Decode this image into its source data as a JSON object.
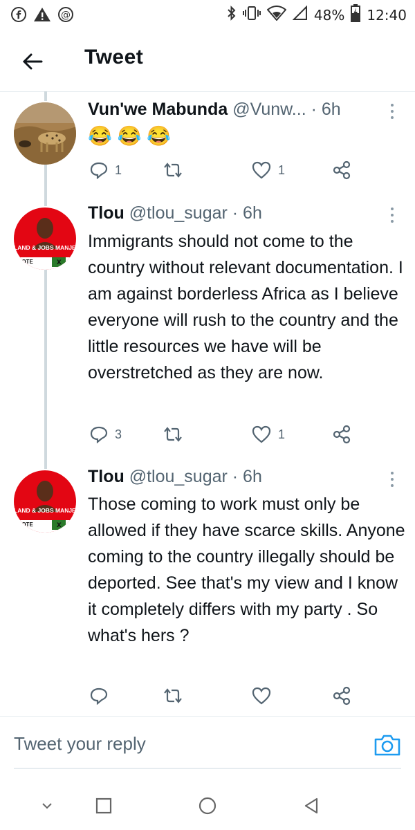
{
  "status_bar": {
    "left_icons": [
      "facebook-icon",
      "warning-icon",
      "at-icon"
    ],
    "battery": "48%",
    "time": "12:40"
  },
  "header": {
    "title": "Tweet"
  },
  "tweets": [
    {
      "name": "Vun'we Mabunda",
      "handle_time": "@Vunw... · 6h",
      "text": "😂 😂 😂",
      "replies": "1",
      "retweets": "",
      "likes": "1"
    },
    {
      "name": "Tlou",
      "handle_time": "@tlou_sugar · 6h",
      "text": "Immigrants should not come to the country without relevant documentation. I am against borderless Africa as I believe everyone will rush to the country and the little resources we have will be overstretched as they are now.",
      "replies": "3",
      "retweets": "",
      "likes": "1",
      "avatar_text": "LAND & JOBS MANJE!",
      "avatar_vote": "VOTE"
    },
    {
      "name": "Tlou",
      "handle_time": "@tlou_sugar · 6h",
      "text": "Those coming to work must only be allowed if they have scarce skills. Anyone coming to the country illegally should be deported. See that's my view and I know it completely differs with my party . So what's hers ?",
      "replies": "",
      "retweets": "",
      "likes": "",
      "avatar_text": "LAND & JOBS MANJE!",
      "avatar_vote": "VOTE"
    }
  ],
  "reply": {
    "placeholder": "Tweet your reply"
  },
  "colors": {
    "accent": "#1d9bf0",
    "text": "#0f1419",
    "muted": "#536471",
    "eff_red": "#e30613"
  }
}
